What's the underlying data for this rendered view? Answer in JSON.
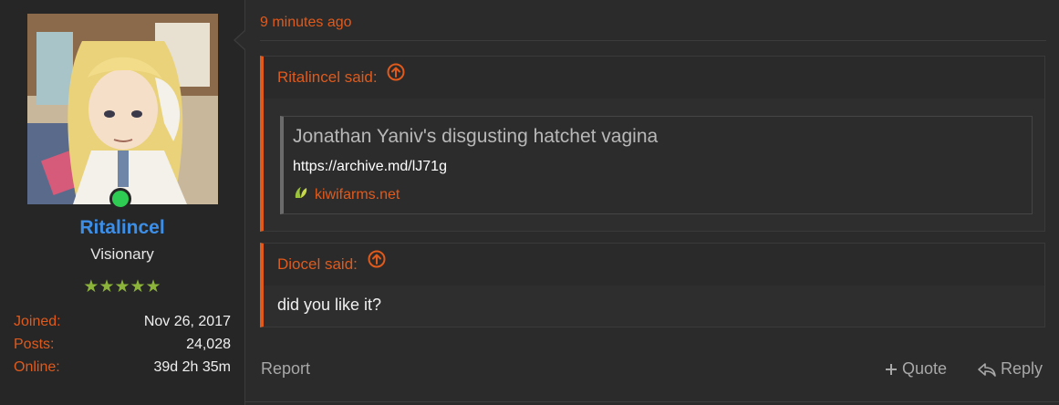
{
  "user": {
    "username": "Ritalincel",
    "title": "Visionary",
    "stars": "★★★★★",
    "online": true,
    "stats": [
      {
        "label": "Joined:",
        "value": "Nov 26, 2017"
      },
      {
        "label": "Posts:",
        "value": "24,028"
      },
      {
        "label": "Online:",
        "value": "39d 2h 35m"
      }
    ]
  },
  "post": {
    "timestamp": "9 minutes ago",
    "quotes": [
      {
        "author_line": "Ritalincel said:",
        "embed": {
          "title": "Jonathan Yaniv's disgusting hatchet vagina",
          "url": "https://archive.md/lJ71g",
          "site": "kiwifarms.net"
        }
      },
      {
        "author_line": "Diocel said:",
        "body": "did you like it?"
      }
    ]
  },
  "actions": {
    "report": "Report",
    "quote": "Quote",
    "reply": "Reply"
  },
  "colors": {
    "accent": "#e05a1c",
    "username": "#3d8ee6",
    "online": "#2ecc52",
    "stars": "#8cb33a"
  }
}
